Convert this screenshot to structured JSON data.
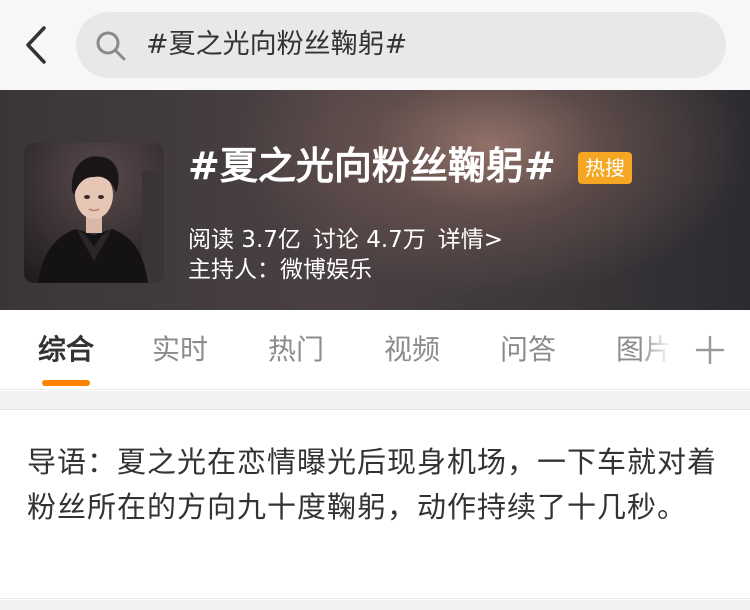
{
  "search": {
    "query": "#夏之光向粉丝鞠躬#"
  },
  "topic": {
    "title": "#夏之光向粉丝鞠躬#",
    "badge": "热搜",
    "reads": "阅读 3.7亿",
    "discussions": "讨论 4.7万",
    "details_link": "详情>",
    "host": "主持人：微博娱乐"
  },
  "tabs": [
    {
      "label": "综合",
      "active": true
    },
    {
      "label": "实时"
    },
    {
      "label": "热门"
    },
    {
      "label": "视频"
    },
    {
      "label": "问答"
    },
    {
      "label": "图片"
    }
  ],
  "intro": {
    "text": "导语：夏之光在恋情曝光后现身机场，一下车就对着粉丝所在的方向九十度鞠躬，动作持续了十几秒。"
  },
  "colors": {
    "accent": "#ff8200",
    "badge": "#f5a623",
    "banner_dark": "#3a3638",
    "text_primary": "#333333",
    "text_secondary": "#8c8c8c"
  },
  "icons": [
    "back-arrow-icon",
    "search-icon",
    "plus-icon"
  ]
}
